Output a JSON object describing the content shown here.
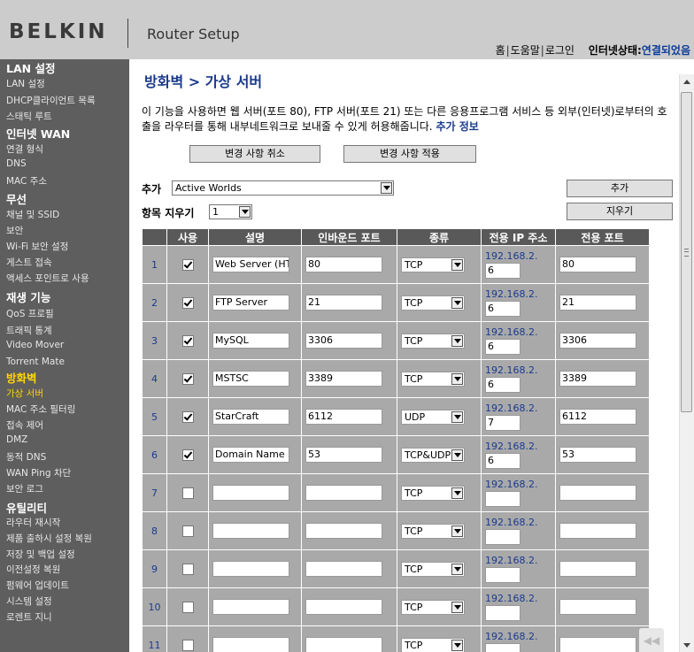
{
  "header": {
    "logo": "BELKIN",
    "product": "Router Setup",
    "nav": [
      "홈",
      "도움말",
      "로그인"
    ],
    "status_label": "인터넷상태:",
    "status_value": "연결되었음"
  },
  "sidebar": {
    "sections": [
      {
        "title": "LAN 설정",
        "items": [
          "LAN 설정",
          "DHCP클라이언트 목록",
          "스태틱 루트"
        ]
      },
      {
        "title": "인터넷 WAN",
        "items": [
          "연결 형식",
          "DNS",
          "MAC 주소"
        ]
      },
      {
        "title": "무선",
        "items": [
          "채널 및 SSID",
          "보안",
          "Wi-Fi 보안 설정",
          "게스트 접속",
          "액세스 포인트로 사용"
        ]
      },
      {
        "title": "재생 기능",
        "items": [
          "QoS 프로필",
          "트래픽 통계",
          "Video Mover",
          "Torrent Mate"
        ]
      },
      {
        "title": "방화벽",
        "items": [
          "가상 서버",
          "MAC 주소 필터링",
          "접속 제어",
          "DMZ",
          "동적 DNS",
          "WAN Ping 차단",
          "보안 로그"
        ]
      },
      {
        "title": "유틸리티",
        "items": [
          "라우터 재시작",
          "제품 출하시 설정 복원",
          "저장 및 백업 설정",
          "이전설정 복원",
          "펌웨어 업데이트",
          "시스템 설정",
          "로렌트 지니"
        ]
      }
    ]
  },
  "main": {
    "title": "방화벽 > 가상 서버",
    "description": "이 기능을 사용하면 웹 서버(포트 80), FTP 서버(포트 21) 또는 다른 응용프로그램 서비스 등 외부(인터넷)로부터의 호출을 라우터를 통해 내부네트워크로 보내줄 수 있게 허용해줍니다.",
    "more_info": "추가 정보",
    "cancel_button": "변경 사항 취소",
    "apply_button": "변경 사항 적용",
    "add_label": "추가",
    "add_select_value": "Active Worlds",
    "add_button": "추가",
    "delete_label": "항목 지우기",
    "delete_select_value": "1",
    "delete_button": "지우기",
    "table": {
      "headers": [
        "",
        "사용",
        "설명",
        "인바운드 포트",
        "종류",
        "전용 IP 주소",
        "전용 포트"
      ],
      "ip_prefix": "192.168.2.",
      "rows": [
        {
          "num": "1",
          "enabled": true,
          "desc": "Web Server (HTT",
          "inbound": "80",
          "type": "TCP",
          "ip": "6",
          "private": "80"
        },
        {
          "num": "2",
          "enabled": true,
          "desc": "FTP Server",
          "inbound": "21",
          "type": "TCP",
          "ip": "6",
          "private": "21"
        },
        {
          "num": "3",
          "enabled": true,
          "desc": "MySQL",
          "inbound": "3306",
          "type": "TCP",
          "ip": "6",
          "private": "3306"
        },
        {
          "num": "4",
          "enabled": true,
          "desc": "MSTSC",
          "inbound": "3389",
          "type": "TCP",
          "ip": "6",
          "private": "3389"
        },
        {
          "num": "5",
          "enabled": true,
          "desc": "StarCraft",
          "inbound": "6112",
          "type": "UDP",
          "ip": "7",
          "private": "6112"
        },
        {
          "num": "6",
          "enabled": true,
          "desc": "Domain Name Ser",
          "inbound": "53",
          "type": "TCP&UDP",
          "ip": "6",
          "private": "53"
        },
        {
          "num": "7",
          "enabled": false,
          "desc": "",
          "inbound": "",
          "type": "TCP",
          "ip": "",
          "private": ""
        },
        {
          "num": "8",
          "enabled": false,
          "desc": "",
          "inbound": "",
          "type": "TCP",
          "ip": "",
          "private": ""
        },
        {
          "num": "9",
          "enabled": false,
          "desc": "",
          "inbound": "",
          "type": "TCP",
          "ip": "",
          "private": ""
        },
        {
          "num": "10",
          "enabled": false,
          "desc": "",
          "inbound": "",
          "type": "TCP",
          "ip": "",
          "private": ""
        },
        {
          "num": "11",
          "enabled": false,
          "desc": "",
          "inbound": "",
          "type": "TCP",
          "ip": "",
          "private": ""
        }
      ]
    }
  },
  "colors": {
    "header_bg": "#cccccc",
    "sidebar_bg": "#5e5e5e",
    "active_item": "#ffd700",
    "title_blue": "#1a3a8c",
    "table_header": "#595959",
    "table_cell": "#a9a9a9"
  }
}
